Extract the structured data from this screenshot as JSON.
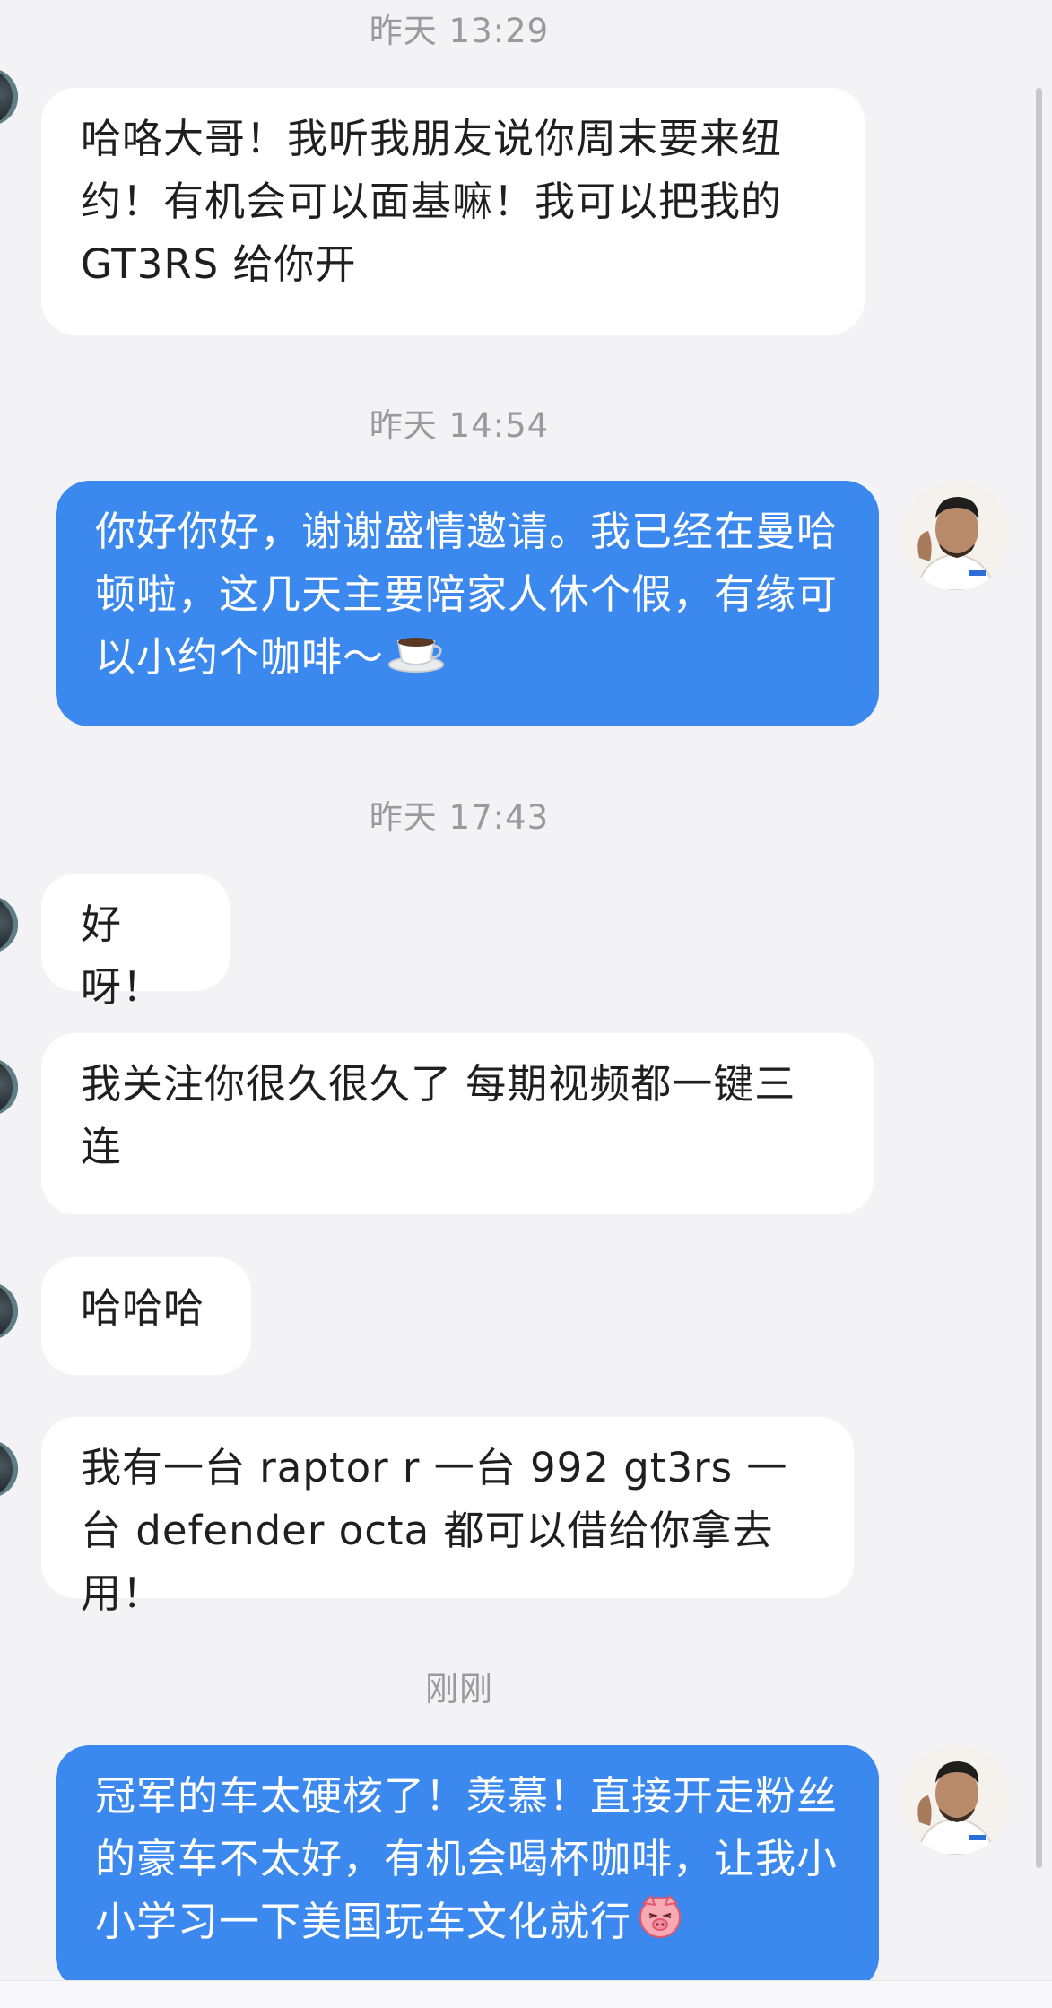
{
  "conversation": {
    "timestamps": [
      "昨天 13:29",
      "昨天 14:54",
      "昨天 17:43",
      "刚刚"
    ],
    "messages": [
      {
        "sender": "other",
        "text": "哈咯大哥！我听我朋友说你周末要来纽约！有机会可以面基嘛！我可以把我的 GT3RS 给你开"
      },
      {
        "sender": "me",
        "text": "你好你好，谢谢盛情邀请。我已经在曼哈顿啦，这几天主要陪家人休个假，有缘可以小约个咖啡～",
        "emoji": "coffee-icon"
      },
      {
        "sender": "other",
        "text": "好呀！"
      },
      {
        "sender": "other",
        "text": "我关注你很久很久了 每期视频都一键三连"
      },
      {
        "sender": "other",
        "text": "哈哈哈"
      },
      {
        "sender": "other",
        "text": "我有一台 raptor r 一台 992 gt3rs 一台 defender octa 都可以借给你拿去用！"
      },
      {
        "sender": "me",
        "text": "冠军的车太硬核了！羡慕！直接开走粉丝的豪车不太好，有机会喝杯咖啡，让我小小学习一下美国玩车文化就行",
        "emoji": "blushing-pig-emoji-icon"
      }
    ]
  },
  "colors": {
    "background": "#f3f3f5",
    "incoming_bubble": "#ffffff",
    "outgoing_bubble": "#3b88ee",
    "timestamp_text": "#9a9a9e"
  }
}
